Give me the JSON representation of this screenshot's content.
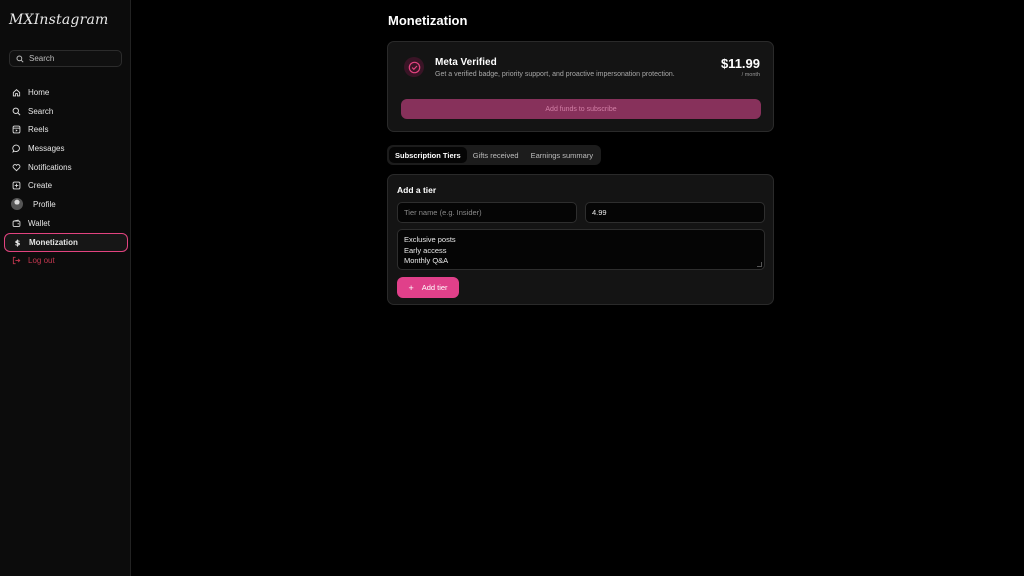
{
  "app": {
    "logo": "MXInstagram"
  },
  "sidebar": {
    "search_placeholder": "Search",
    "items": [
      {
        "label": "Home",
        "icon": "home-icon"
      },
      {
        "label": "Search",
        "icon": "search-icon"
      },
      {
        "label": "Reels",
        "icon": "reels-icon"
      },
      {
        "label": "Messages",
        "icon": "messages-icon"
      },
      {
        "label": "Notifications",
        "icon": "heart-icon"
      },
      {
        "label": "Create",
        "icon": "plus-square-icon"
      },
      {
        "label": "Profile",
        "icon": "avatar"
      },
      {
        "label": "Wallet",
        "icon": "wallet-icon"
      },
      {
        "label": "Monetization",
        "icon": "dollar-icon",
        "active": true
      },
      {
        "label": "Log out",
        "icon": "logout-icon"
      }
    ]
  },
  "main": {
    "title": "Monetization",
    "verified": {
      "title": "Meta Verified",
      "description": "Get a verified badge, priority support, and proactive impersonation protection.",
      "price": "$11.99",
      "period": "/ month",
      "button": "Add funds to subscribe"
    },
    "tabs": [
      {
        "label": "Subscription Tiers",
        "active": true
      },
      {
        "label": "Gifts received"
      },
      {
        "label": "Earnings summary"
      }
    ],
    "tier_form": {
      "heading": "Add a tier",
      "name_placeholder": "Tier name (e.g. Insider)",
      "price_value": "4.99",
      "perks": [
        "Exclusive posts",
        "Early access",
        "Monthly Q&A"
      ],
      "add_button": "Add tier"
    }
  },
  "colors": {
    "accent": "#e0408a",
    "accent_muted": "#87315b",
    "logout": "#c2374f"
  }
}
